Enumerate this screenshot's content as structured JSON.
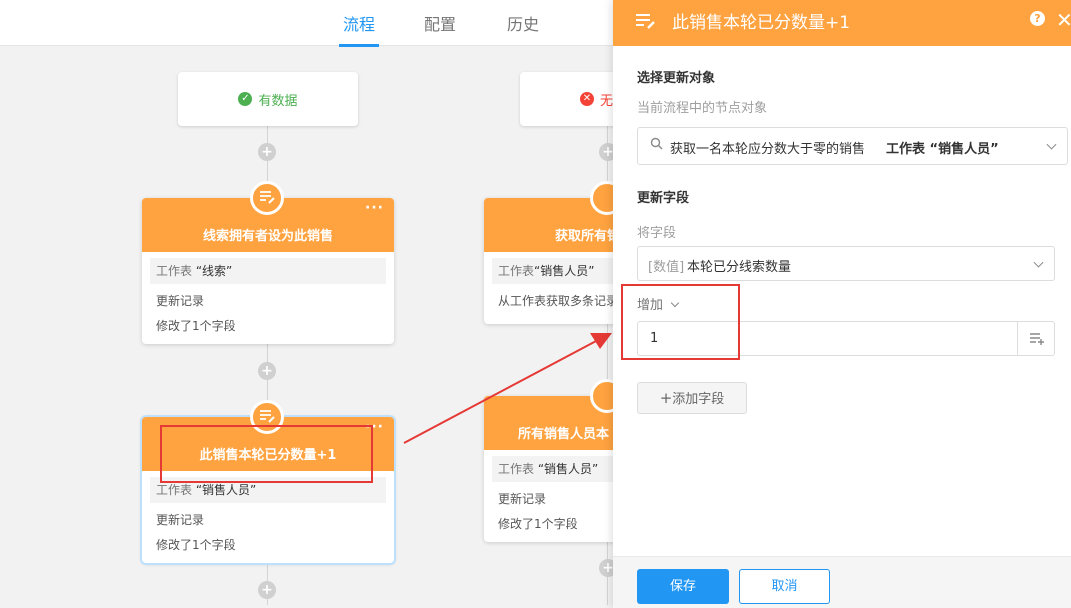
{
  "nav": {
    "tabs": [
      {
        "label": "流程",
        "active": true
      },
      {
        "label": "配置",
        "active": false
      },
      {
        "label": "历史",
        "active": false
      }
    ]
  },
  "flow": {
    "result_has_data": "有数据",
    "result_no_data": "无",
    "nodes": [
      {
        "title": "线索拥有者设为此销售",
        "ws_prefix": "工作表",
        "ws_name": "“线索”",
        "line1": "更新记录",
        "line2": "修改了1个字段"
      },
      {
        "title": "获取所有销",
        "ws_prefix": "工作表",
        "ws_name": "“销售人员”",
        "line1": "从工作表获取多条记录",
        "line2": ""
      },
      {
        "title": "此销售本轮已分数量+1",
        "ws_prefix": "工作表",
        "ws_name": "“销售人员”",
        "line1": "更新记录",
        "line2": "修改了1个字段"
      },
      {
        "title": "所有销售人员本",
        "ws_prefix": "工作表",
        "ws_name": "“销售人员”",
        "line1": "更新记录",
        "line2": "修改了1个字段"
      }
    ],
    "more": "···",
    "plus": "+"
  },
  "panel": {
    "title": "此销售本轮已分数量+1",
    "help": "?",
    "close": "✕",
    "section1_title": "选择更新对象",
    "section1_sub": "当前流程中的节点对象",
    "target_select": {
      "text": "获取一名本轮应分数大于零的销售",
      "bold": "工作表 “销售人员”"
    },
    "section2_title": "更新字段",
    "field_label": "将字段",
    "field_select": {
      "type": "[数值]",
      "name": "本轮已分线索数量"
    },
    "op_label": "增加",
    "value_input": "1",
    "add_field": "添加字段",
    "save": "保存",
    "cancel": "取消"
  },
  "colors": {
    "accent": "#2196f3",
    "orange": "#ffa340",
    "red": "#e53935",
    "green": "#4caf50"
  }
}
